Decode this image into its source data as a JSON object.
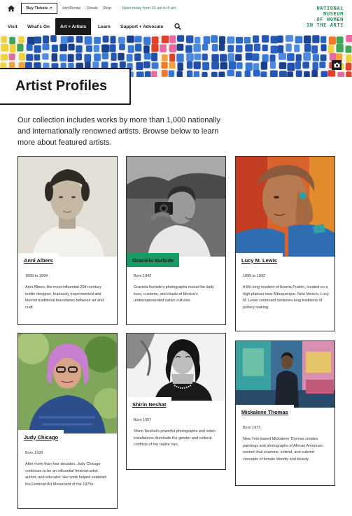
{
  "utility": {
    "tickets_label": "Buy Tickets",
    "links": [
      "Join/Renew",
      "Donate",
      "Shop"
    ],
    "hours": "Open today from 10 am to 5 pm",
    "logo_lines": [
      "NATIONAL",
      "MUSEUM",
      "OF WOMEN",
      "IN THE ARTS"
    ]
  },
  "nav": {
    "items": [
      "Visit",
      "What's On",
      "Art + Artists",
      "Learn",
      "Support + Advocate"
    ],
    "active": "Art + Artists"
  },
  "page": {
    "title": "Artist Profiles",
    "intro": "Our collection includes works by more than 1,000 nationally and internationally renowned artists. Browse below to learn more about featured artists."
  },
  "artists": [
    {
      "name": "Anni Albers",
      "years": "1899 to 1994",
      "description": "Anni Albers, the most influential 20th-century textile designer, fearlessly experimented and blurred traditional boundaries between art and craft."
    },
    {
      "name": "Graciela Iturbide",
      "years": "Born 1942",
      "description": "Graciela Iturbide's photographs reveal the daily lives, customs, and rituals of Mexico's underrepresented native cultures."
    },
    {
      "name": "Lucy M. Lewis",
      "years": "1895 to 1992",
      "description": "A life-long resident of Acoma Pueblo, located on a high plateau near Albuquerque, New Mexico, Lucy M. Lewis continued centuries-long traditions of pottery making."
    },
    {
      "name": "Judy Chicago",
      "years": "Born 1939",
      "description": "After more than four decades, Judy Chicago continues to be an influential feminist artist, author, and educator. Her work helped establish the Feminist Art Movement of the 1970s."
    },
    {
      "name": "Shirin Neshat",
      "years": "Born 1957",
      "description": "Shirin Neshat's powerful photographs and video installations illuminate the gender and cultural conflicts of her native Iran."
    },
    {
      "name": "Mickalene Thomas",
      "years": "Born 1971",
      "description": "New York-based Mickalene Thomas creates paintings and photographs of African American women that examine, extend, and subvert concepts of female identity and beauty."
    }
  ],
  "colors": {
    "accent_green": "#1a9a65",
    "logo_green": "#159a5a",
    "dark": "#1a1a1a"
  },
  "icons": [
    "home-icon",
    "external-link-icon",
    "search-icon",
    "camera-icon"
  ]
}
